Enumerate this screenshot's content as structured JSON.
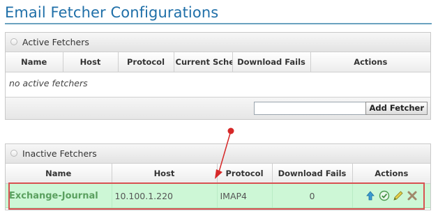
{
  "page": {
    "title": "Email Fetcher Configurations"
  },
  "active_panel": {
    "title": "Active Fetchers",
    "columns": [
      "Name",
      "Host",
      "Protocol",
      "Current Sched",
      "Download Fails",
      "Actions"
    ],
    "empty_text": "no active fetchers",
    "new_fetcher_input": {
      "value": "",
      "placeholder": ""
    },
    "add_button_label": "Add Fetcher"
  },
  "inactive_panel": {
    "title": "Inactive Fetchers",
    "columns": [
      "Name",
      "Host",
      "Protocol",
      "Download Fails",
      "Actions"
    ],
    "rows": [
      {
        "name": "Exchange-Journal",
        "host": "10.100.1.220",
        "protocol": "IMAP4",
        "download_fails": "0",
        "actions": [
          "move-up-icon",
          "activate-check-icon",
          "edit-pencil-icon",
          "delete-x-icon"
        ]
      }
    ]
  },
  "colors": {
    "title": "#1f6fa8",
    "row_highlight": "#cdf7d6",
    "annotation": "#d62828"
  }
}
